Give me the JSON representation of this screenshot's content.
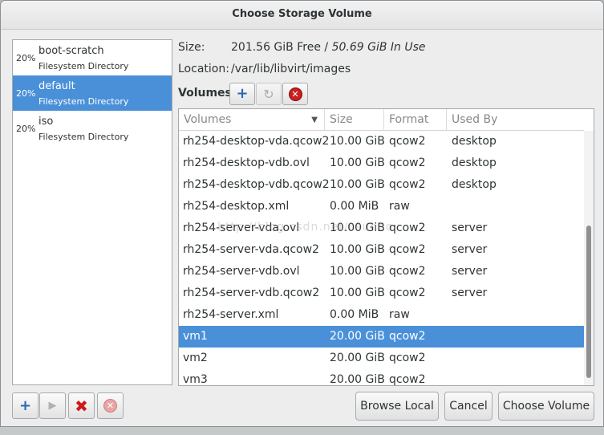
{
  "window": {
    "title": "Choose Storage Volume"
  },
  "pools": [
    {
      "percent": "20%",
      "name": "boot-scratch",
      "type": "Filesystem Directory",
      "selected": false
    },
    {
      "percent": "20%",
      "name": "default",
      "type": "Filesystem Directory",
      "selected": true
    },
    {
      "percent": "20%",
      "name": "iso",
      "type": "Filesystem Directory",
      "selected": false
    }
  ],
  "info": {
    "size_label": "Size:",
    "size_free": "201.56 GiB Free / ",
    "size_inuse": "50.69 GiB In Use",
    "location_label": "Location:",
    "location_value": "/var/lib/libvirt/images"
  },
  "volumes_toolbar": {
    "label": "Volumes",
    "add_icon": "plus-icon",
    "refresh_icon": "refresh-icon",
    "delete_icon": "delete-icon"
  },
  "table": {
    "headers": [
      "Volumes",
      "Size",
      "Format",
      "Used By"
    ],
    "rows": [
      [
        "rh254-desktop-vda.qcow2",
        "10.00 GiB",
        "qcow2",
        "desktop"
      ],
      [
        "rh254-desktop-vdb.ovl",
        "10.00 GiB",
        "qcow2",
        "desktop"
      ],
      [
        "rh254-desktop-vdb.qcow2",
        "10.00 GiB",
        "qcow2",
        "desktop"
      ],
      [
        "rh254-desktop.xml",
        "0.00 MiB",
        "raw",
        ""
      ],
      [
        "rh254-server-vda.ovl",
        "10.00 GiB",
        "qcow2",
        "server"
      ],
      [
        "rh254-server-vda.qcow2",
        "10.00 GiB",
        "qcow2",
        "server"
      ],
      [
        "rh254-server-vdb.ovl",
        "10.00 GiB",
        "qcow2",
        "server"
      ],
      [
        "rh254-server-vdb.qcow2",
        "10.00 GiB",
        "qcow2",
        "server"
      ],
      [
        "rh254-server.xml",
        "0.00 MiB",
        "raw",
        ""
      ],
      [
        "vm1",
        "20.00 GiB",
        "qcow2",
        ""
      ],
      [
        "vm2",
        "20.00 GiB",
        "qcow2",
        ""
      ],
      [
        "vm3",
        "20.00 GiB",
        "qcow2",
        ""
      ]
    ],
    "selected_row": 9
  },
  "watermark": "http://blog.csdn.net/csuhoo",
  "pool_buttons": {
    "add_icon": "plus-icon",
    "start_icon": "play-icon",
    "stop_icon": "stop-icon",
    "delete_icon": "delete-icon"
  },
  "buttons": {
    "browse_local": "Browse Local",
    "cancel": "Cancel",
    "choose_volume": "Choose Volume"
  },
  "colors": {
    "selection": "#4a90d9",
    "delete_red": "#cc1f1f",
    "add_blue": "#2a66b8"
  }
}
